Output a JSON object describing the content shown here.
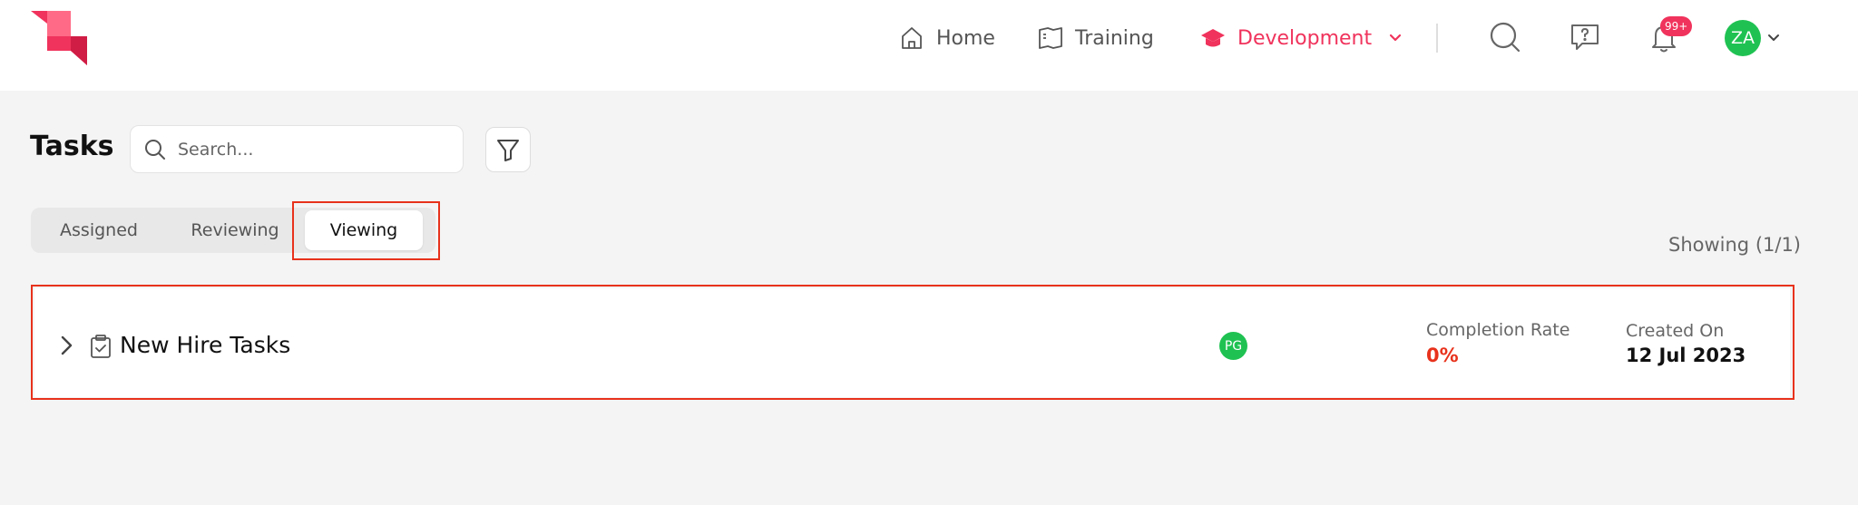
{
  "nav": {
    "items": [
      {
        "label": "Home",
        "icon": "home-icon"
      },
      {
        "label": "Training",
        "icon": "book-icon"
      },
      {
        "label": "Development",
        "icon": "graduation-cap-icon"
      }
    ],
    "active_color": "#f0335c",
    "notification_badge": "99+",
    "user_initials": "ZA"
  },
  "page": {
    "title": "Tasks",
    "search_placeholder": "Search...",
    "showing": "Showing (1/1)"
  },
  "tabs": [
    {
      "label": "Assigned",
      "active": false
    },
    {
      "label": "Reviewing",
      "active": false
    },
    {
      "label": "Viewing",
      "active": true
    }
  ],
  "tasks": [
    {
      "title": "New Hire Tasks",
      "assignee_initials": "PG",
      "completion_rate_label": "Completion Rate",
      "completion_rate_value": "0%",
      "created_on_label": "Created On",
      "created_on_value": "12 Jul 2023"
    }
  ],
  "colors": {
    "brand": "#f0335c",
    "avatar": "#1fc252",
    "highlight": "#e8321c",
    "background": "#f4f4f4"
  }
}
